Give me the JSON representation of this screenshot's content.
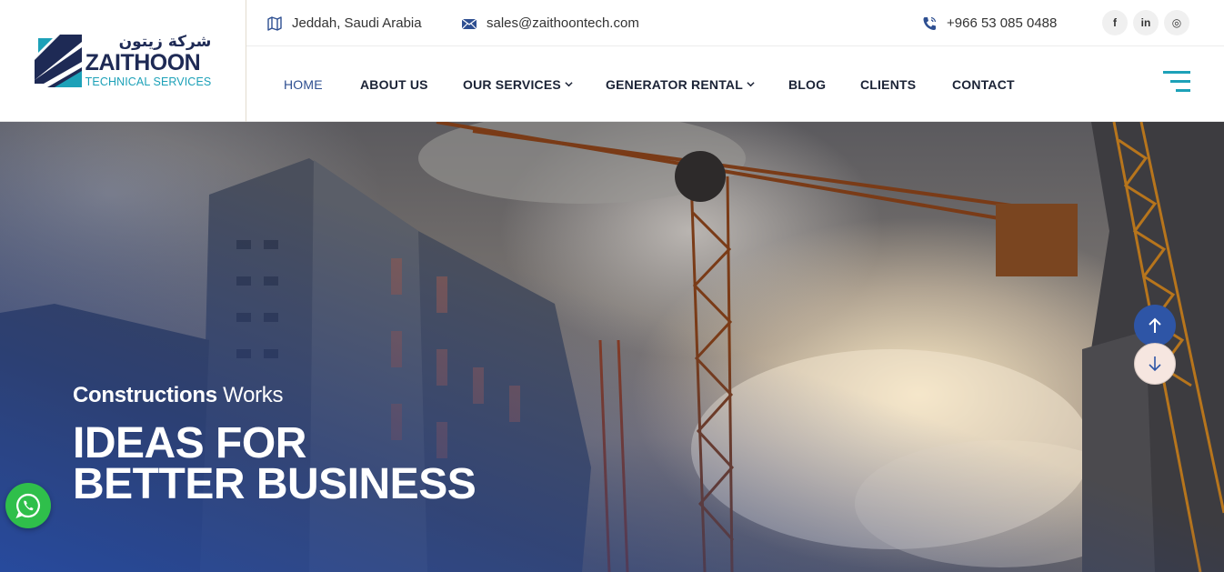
{
  "brand": {
    "arabic_name": "شركة زيتون",
    "name": "ZAITHOON",
    "tagline": "TECHNICAL SERVICES",
    "colors": {
      "navy": "#1e2a55",
      "teal": "#1da1b8",
      "accent_blue": "#2e4f91"
    }
  },
  "topbar": {
    "location": {
      "icon": "map-icon",
      "text": "Jeddah, Saudi Arabia"
    },
    "email": {
      "icon": "envelope-icon",
      "text": "sales@zaithoontech.com"
    },
    "phone": {
      "icon": "phone-icon",
      "text": "+966 53 085 0488"
    },
    "socials": [
      {
        "icon": "facebook-icon",
        "label": "f"
      },
      {
        "icon": "linkedin-icon",
        "label": "in"
      },
      {
        "icon": "instagram-icon",
        "label": "◎"
      }
    ]
  },
  "nav": {
    "items": [
      {
        "label": "HOME",
        "active": true
      },
      {
        "label": "ABOUT US"
      },
      {
        "label": "OUR SERVICES",
        "dropdown": true
      },
      {
        "label": "GENERATOR RENTAL",
        "dropdown": true
      },
      {
        "label": "BLOG"
      },
      {
        "label": "CLIENTS"
      },
      {
        "label": "CONTACT"
      }
    ],
    "menu_icon": "hamburger-menu-icon"
  },
  "hero": {
    "kicker_bold": "Constructions",
    "kicker_rest": " Works",
    "title_line1": "IDEAS FOR",
    "title_line2": "BETTER BUSINESS"
  },
  "controls": {
    "scroll_up_icon": "arrow-up-icon",
    "scroll_down_icon": "arrow-down-icon",
    "whatsapp_icon": "whatsapp-icon"
  }
}
